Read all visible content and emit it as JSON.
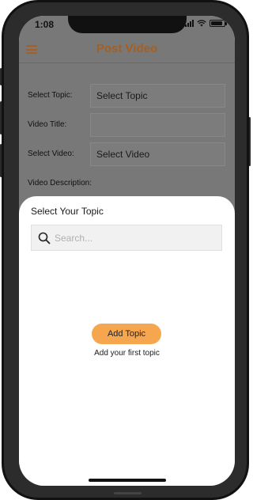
{
  "status_bar": {
    "time": "1:08",
    "battery_level": 0.85
  },
  "app_bar": {
    "title": "Post Video",
    "menu_icon": "hamburger-menu-icon"
  },
  "form": {
    "topic": {
      "label": "Select Topic:",
      "value": "Select Topic"
    },
    "title": {
      "label": "Video Title:",
      "value": ""
    },
    "video": {
      "label": "Select Video:",
      "value": "Select Video"
    },
    "description": {
      "label": "Video Description:"
    }
  },
  "sheet": {
    "title": "Select Your Topic",
    "search": {
      "placeholder": "Search...",
      "icon": "search-icon"
    },
    "add_button": "Add Topic",
    "empty_hint": "Add your first topic"
  },
  "colors": {
    "accent": "#a55f22",
    "button": "#f7a650",
    "overlay": "#787878"
  }
}
